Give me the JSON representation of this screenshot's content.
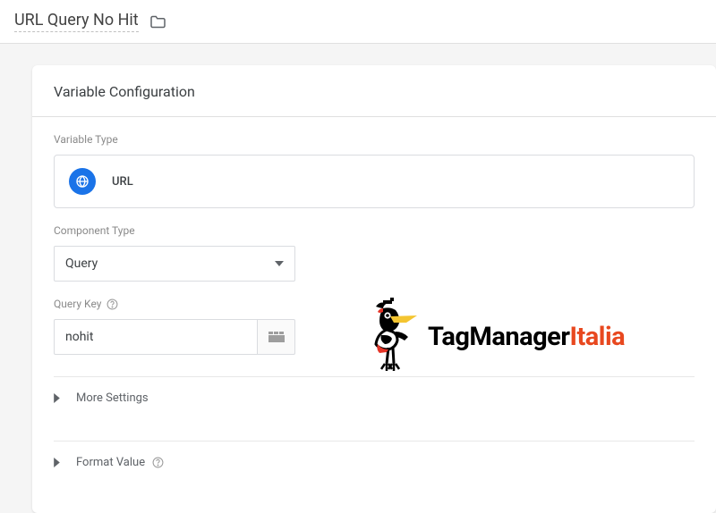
{
  "header": {
    "title": "URL Query No Hit"
  },
  "card": {
    "title": "Variable Configuration",
    "variable_type_label": "Variable Type",
    "variable_type_value": "URL",
    "component_type_label": "Component Type",
    "component_type_value": "Query",
    "query_key_label": "Query Key",
    "query_key_value": "nohit",
    "more_settings": "More Settings",
    "format_value": "Format Value"
  },
  "logo": {
    "part1": "TagManager",
    "part2": "Italia"
  }
}
